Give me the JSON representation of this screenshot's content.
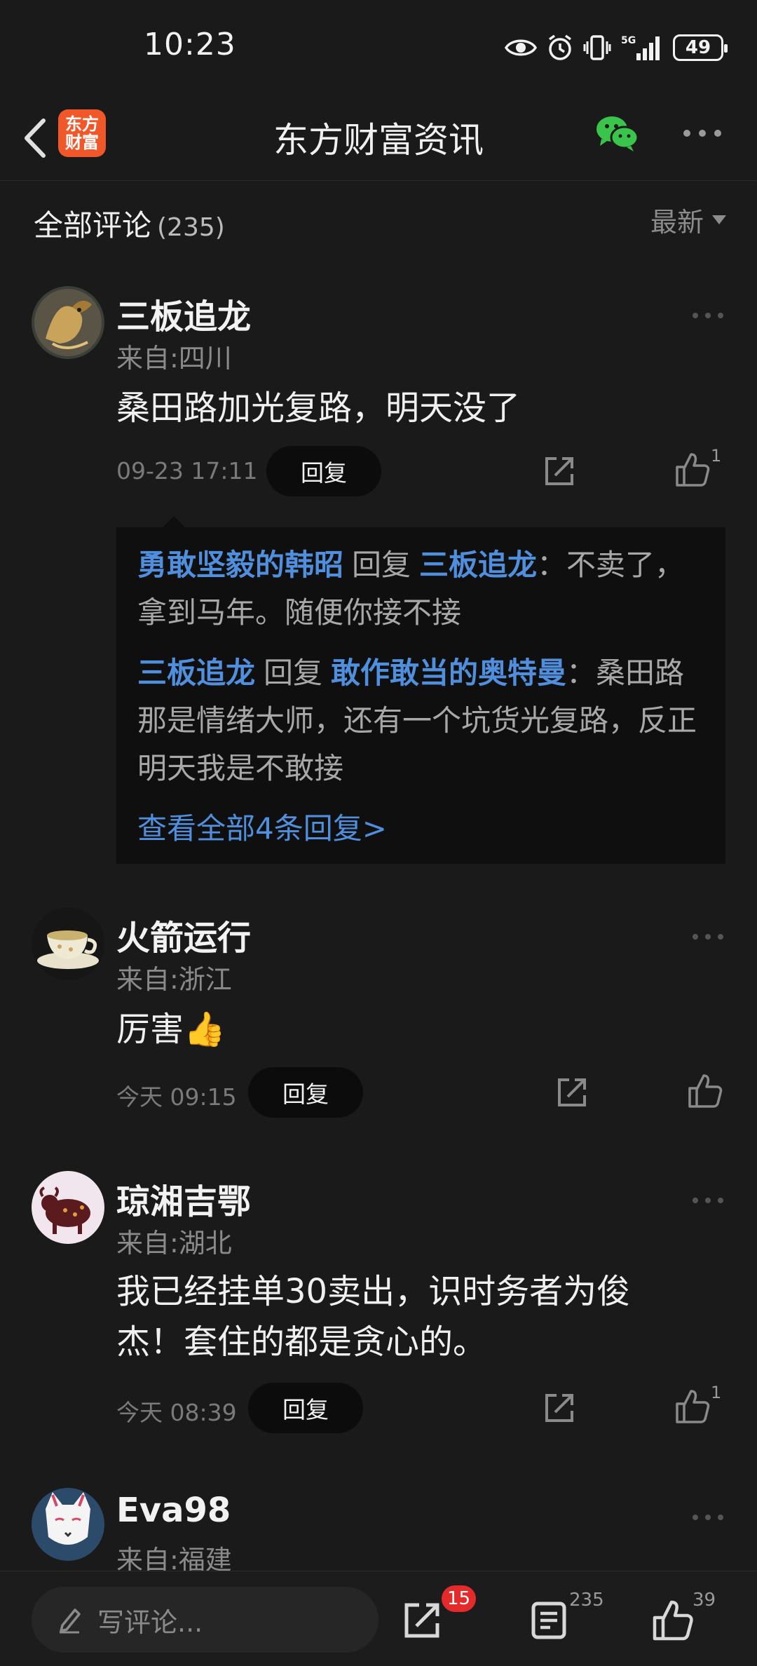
{
  "status_bar": {
    "time": "10:23",
    "network": "5G",
    "battery": "49"
  },
  "nav": {
    "logo_line1": "东方",
    "logo_line2": "财富",
    "title": "东方财富资讯"
  },
  "comments_header": {
    "title": "全部评论",
    "count": "(235)",
    "sort": "最新"
  },
  "comments": [
    {
      "user": "三板追龙",
      "location": "来自:四川",
      "text": "桑田路加光复路，明天没了",
      "time": "09-23 17:11",
      "reply_label": "回复",
      "likes": "1",
      "replies": [
        {
          "from": "勇敢坚毅的韩昭",
          "verb": "回复",
          "to": "三板追龙",
          "text": "：不卖了，拿到马年。随便你接不接"
        },
        {
          "from": "三板追龙",
          "verb": "回复",
          "to": "敢作敢当的奥特曼",
          "text": "：桑田路那是情绪大师，还有一个坑货光复路，反正明天我是不敢接"
        }
      ],
      "view_all": "查看全部4条回复>"
    },
    {
      "user": "火箭运行",
      "location": "来自:浙江",
      "text": "厉害👍",
      "time": "今天 09:15",
      "reply_label": "回复",
      "likes": ""
    },
    {
      "user": "琼湘吉鄂",
      "location": "来自:湖北",
      "text_line1": "我已经挂单30卖出，识时务者为俊",
      "text_line2": "杰！套住的都是贪心的。",
      "time": "今天 08:39",
      "reply_label": "回复",
      "likes": "1"
    },
    {
      "user": "Eva98",
      "location": "来自:福建"
    }
  ],
  "bottom_bar": {
    "input_placeholder": "写评论...",
    "share_badge": "15",
    "comment_count": "235",
    "like_count": "39"
  },
  "colors": {
    "background": "#1a1a1a",
    "link": "#4f8fde",
    "badge": "#e42a2a",
    "logo": "#f0582a",
    "wechat": "#3bc44b"
  }
}
